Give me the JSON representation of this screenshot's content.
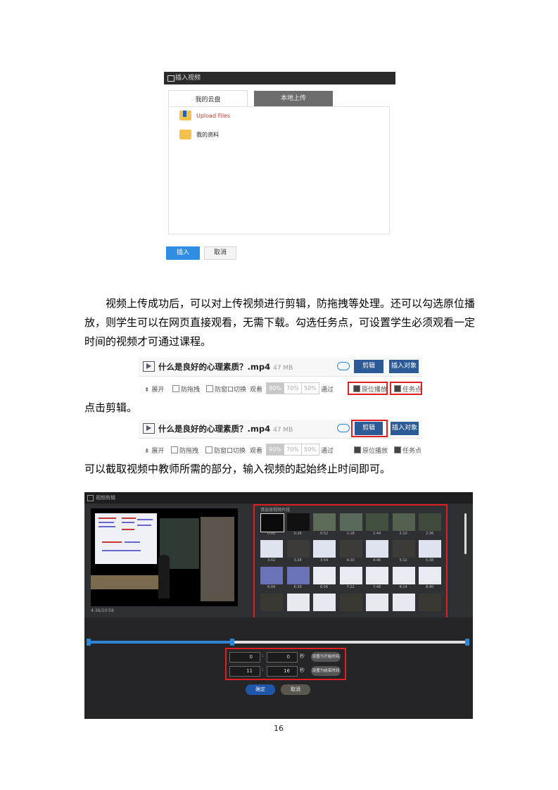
{
  "dialog": {
    "title": "插入视频",
    "tab_active": "我的云盘",
    "tab_inactive": "本地上传",
    "items": [
      {
        "label": "Upload Files",
        "color": "#c0392b"
      },
      {
        "label": "我的资料",
        "color": "#222222"
      }
    ],
    "ok_label": "插入",
    "cancel_label": "取消"
  },
  "paragraph1": "视频上传成功后，可以对上传视频进行剪辑，防拖拽等处理。还可以勾选原位播放，则学生可以在网页直接观看，无需下载。勾选任务点，可设置学生必须观看一定时间的视频才可通过课程。",
  "paragraph2": "点击剪辑。",
  "paragraph3": "可以截取视频中教师所需的部分，输入视频的起始终止时间即可。",
  "video_row": {
    "title": "什么是良好的心理素质？.mp4",
    "size": "47 MB",
    "edit_label": "剪辑",
    "insert_label": "插入对象",
    "options": {
      "expand": "展开",
      "anti_drag": "防拖拽",
      "anti_switch": "防窗口切换",
      "watch": "观看",
      "pct_90": "90%",
      "pct_70": "70%",
      "pct_50": "50%",
      "pass": "通过",
      "inplace": "原位播放",
      "task": "任务点"
    }
  },
  "video_row2": {
    "insert_label": "插入对象"
  },
  "editor": {
    "title": "视频剪辑",
    "thumb_header": "请选择视频片段",
    "thumb_labels": [
      "0:00",
      "0:26",
      "0:52",
      "1:18",
      "1:44",
      "2:10",
      "2:36",
      "3:02",
      "3:28",
      "3:54",
      "4:20",
      "4:46",
      "5:12",
      "5:38",
      "6:04",
      "6:30",
      "6:56",
      "7:22",
      "7:48",
      "8:14",
      "8:40"
    ],
    "time_label": "4:36/10:58",
    "start_min": "0",
    "start_sec": "0",
    "end_min": "11",
    "end_sec": "16",
    "sep_colon": ":",
    "sec_unit": "秒",
    "btn_set_start": "设置为开始时间",
    "btn_set_end": "设置为结束时间",
    "confirm_label": "确定",
    "cancel_label": "取消",
    "selection": 0.37
  },
  "page_number": "16"
}
